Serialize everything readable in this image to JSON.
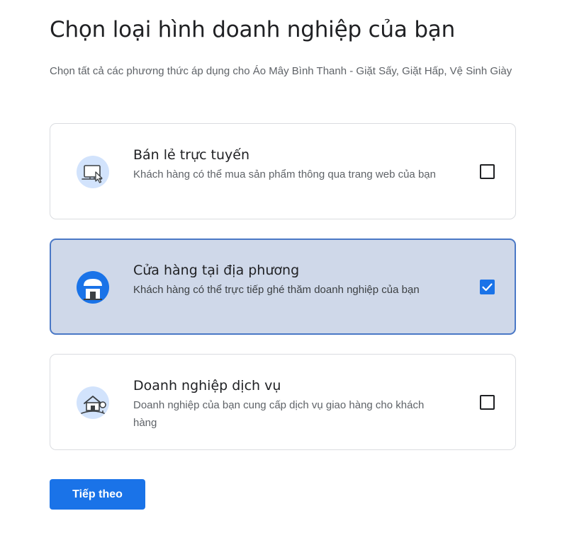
{
  "page": {
    "title": "Chọn loại hình doanh nghiệp của bạn",
    "subtitle": "Chọn tất cả các phương thức áp dụng cho Áo Mây Bình Thanh - Giặt Sấy, Giặt Hấp, Vệ Sinh Giày"
  },
  "options": [
    {
      "title": "Bán lẻ trực tuyến",
      "description": "Khách hàng có thể mua sản phẩm thông qua trang web của bạn",
      "icon": "online-retail-icon",
      "checked": false
    },
    {
      "title": "Cửa hàng tại địa phương",
      "description": "Khách hàng có thể trực tiếp ghé thăm doanh nghiệp của bạn",
      "icon": "storefront-icon",
      "checked": true
    },
    {
      "title": "Doanh nghiệp dịch vụ",
      "description": "Doanh nghiệp của bạn cung cấp dịch vụ giao hàng cho khách hàng",
      "icon": "home-delivery-icon",
      "checked": false
    }
  ],
  "actions": {
    "next_label": "Tiếp theo"
  },
  "colors": {
    "primary": "#1a73e8",
    "selected_card_bg": "#cfd8e9",
    "selected_card_border": "#4a78c6",
    "icon_bg": "#d2e3fc"
  }
}
